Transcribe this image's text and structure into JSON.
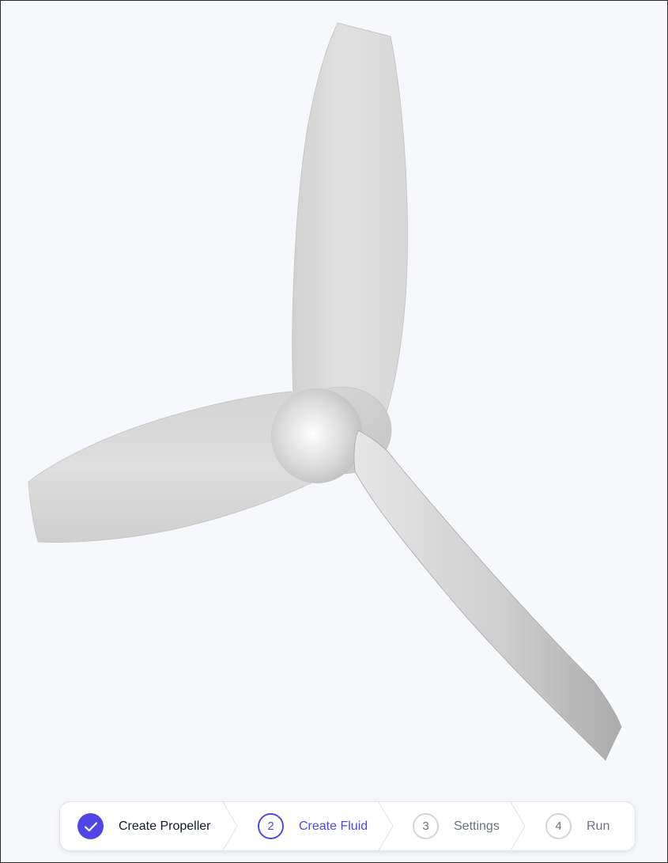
{
  "stepper": {
    "steps": [
      {
        "number": "",
        "label": "Create Propeller",
        "status": "completed",
        "icon": "check-icon"
      },
      {
        "number": "2",
        "label": "Create Fluid",
        "status": "current"
      },
      {
        "number": "3",
        "label": "Settings",
        "status": "upcoming"
      },
      {
        "number": "4",
        "label": "Run",
        "status": "upcoming"
      }
    ]
  },
  "colors": {
    "accent": "#5046e5",
    "background": "#f7f8fc",
    "blade": "#dcdcdc",
    "upcoming": "#6b7280"
  }
}
